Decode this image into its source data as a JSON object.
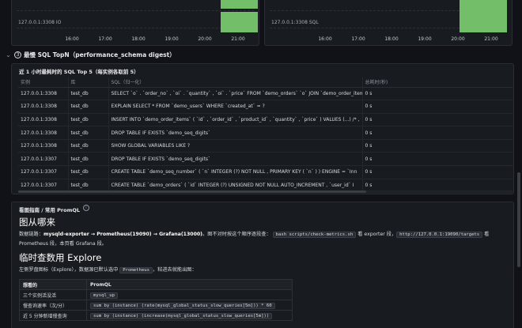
{
  "charts": [
    {
      "label": "127.0.0.1:3308 IO"
    },
    {
      "label": "127.0.0.1:3308 SQL"
    }
  ],
  "time_ticks": [
    "16:00",
    "17:00",
    "18:00",
    "19:00",
    "20:00",
    "21:00"
  ],
  "row": {
    "chevron": "⌄",
    "number": "3",
    "title": "最慢 SQL TopN（performance_schema digest）"
  },
  "table_panel": {
    "title": "近 1 小时最耗时的 SQL Top 5（每实例各取前 5）",
    "columns": [
      "实例",
      "库",
      "SQL（归一化）",
      "总耗时(秒)"
    ],
    "rows": [
      [
        "127.0.0.1:3308",
        "test_db",
        "SELECT `o` . `order_no` , `oi` . `quantity` , `oi` . `price` FROM `demo_orders` `o` JOIN `demo_order_items`",
        "0 s"
      ],
      [
        "127.0.0.1:3308",
        "test_db",
        "EXPLAIN SELECT * FROM `demo_users` WHERE `created_at` = ?",
        "0 s"
      ],
      [
        "127.0.0.1:3308",
        "test_db",
        "INSERT INTO `demo_order_items` ( `id` , `order_id` , `product_id` , `quantity` , `price` ) VALUES (...) /* ,",
        "0 s"
      ],
      [
        "127.0.0.1:3308",
        "test_db",
        "DROP TABLE IF EXISTS `demo_seq_digits`",
        "0 s"
      ],
      [
        "127.0.0.1:3308",
        "test_db",
        "SHOW GLOBAL VARIABLES LIKE ?",
        "0 s"
      ],
      [
        "127.0.0.1:3307",
        "test_db",
        "DROP TABLE IF EXISTS `demo_seq_digits`",
        "0 s"
      ],
      [
        "127.0.0.1:3307",
        "test_db",
        "CREATE TABLE `demo_seq_number` ( `n` INTEGER (?) NOT NULL , PRIMARY KEY ( `n` ) ) ENGINE = `Inn",
        "0 s"
      ],
      [
        "127.0.0.1:3307",
        "test_db",
        "CREATE TABLE `demo_orders` ( `id` INTEGER (?) UNSIGNED NOT NULL AUTO_INCREMENT , `user_id` I",
        "0 s"
      ]
    ]
  },
  "text_panel": {
    "title": "看图指南 / 常用 PromQL",
    "info_icon": "i",
    "h1a": "图从哪来",
    "p1_pre": "数据链路：",
    "p1_chain": "mysqld-exporter → Prometheus(19090) → Grafana(13000)",
    "p1_mid": "。图不对时按这个顺序逐段查：",
    "p1_code1": "bash scripts/check-metrics.sh",
    "p1_mid2": " 看 exporter 段，",
    "p1_code2": "http://127.0.0.1:19090/targets",
    "p1_end": " 看 Prometheus 段，本页看 Grafana 段。",
    "h1b": "临时查数用 Explore",
    "p2_pre": "左侧罗盘图标（Explore），数据源已默认选中 ",
    "p2_code": "Prometheus",
    "p2_end": "，粘进去就能出图：",
    "pq_columns": [
      "想看的",
      "PromQL"
    ],
    "pq_rows": [
      [
        "三个实例活没活",
        "mysql_up"
      ],
      [
        "慢查询速率（次/分）",
        "sum by (instance) (rate(mysql_global_status_slow_queries[5m])) * 60"
      ],
      [
        "近 5 分钟新增慢查询",
        "sum by (instance) (increase(mysql_global_status_slow_queries[5m]))"
      ]
    ]
  },
  "colors": {
    "bar": "#73bf69",
    "panel": "#181b1f",
    "background": "#111217"
  }
}
